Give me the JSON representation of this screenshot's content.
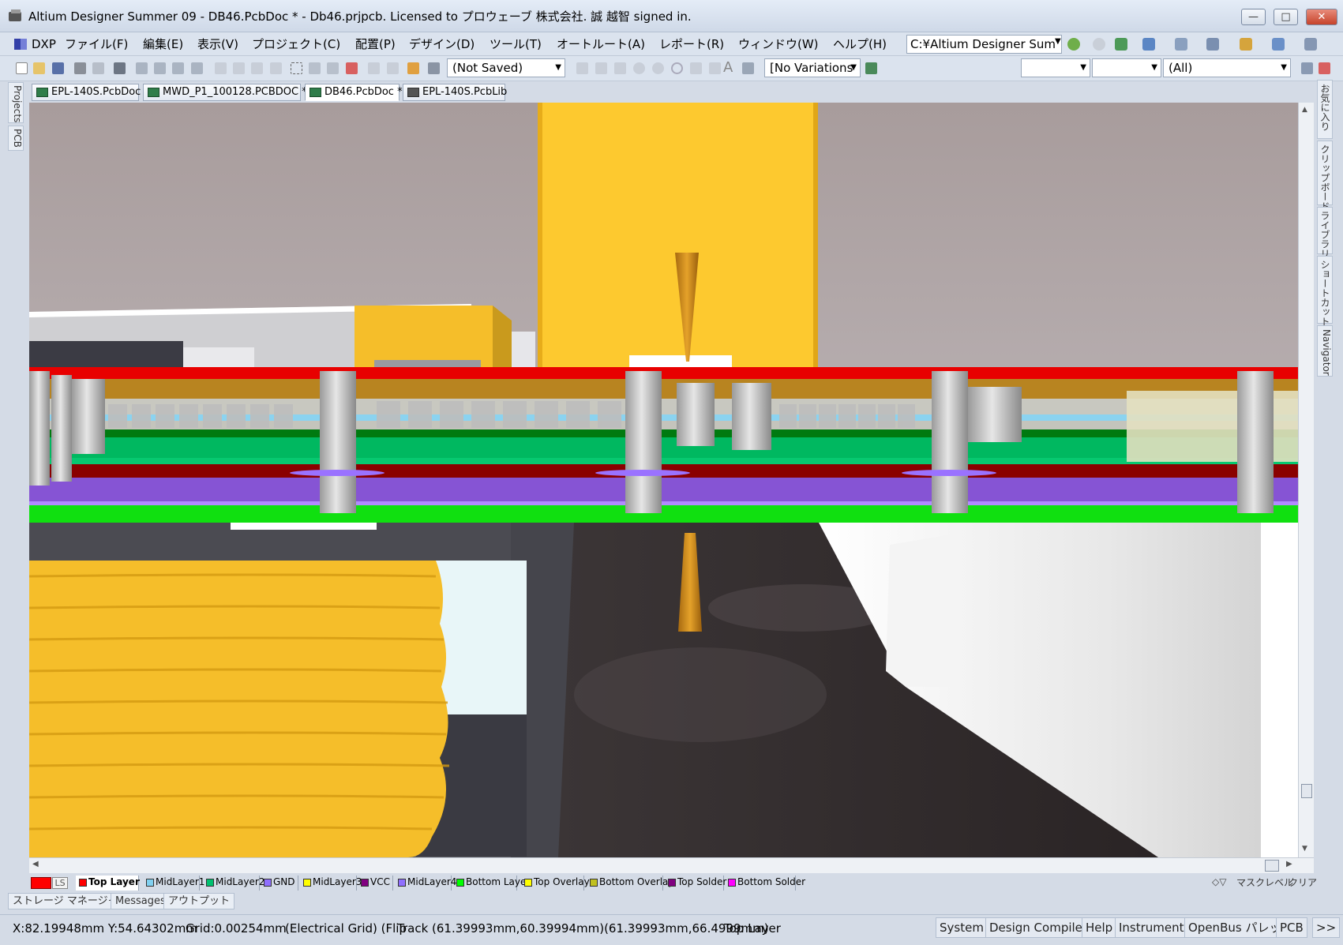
{
  "window": {
    "title": "Altium Designer Summer 09 - DB46.PcbDoc * - Db46.prjpcb. Licensed to プロウェーブ 株式会社. 誠 越智 signed in.",
    "minimize": "—",
    "maximize": "□",
    "close": "✕"
  },
  "menubar": {
    "dxp": "DXP",
    "items": [
      "ファイル(F)",
      "編集(E)",
      "表示(V)",
      "プロジェクト(C)",
      "配置(P)",
      "デザイン(D)",
      "ツール(T)",
      "オートルート(A)",
      "レポート(R)",
      "ウィンドウ(W)",
      "ヘルプ(H)"
    ],
    "path_combo": "C:¥Altium Designer Sum"
  },
  "toolbar": {
    "saved_state": "(Not Saved)",
    "variations": "[No Variations",
    "filter_all": "(All)"
  },
  "left_panels": [
    "Projects",
    "PCB"
  ],
  "right_panels": [
    "お気に入り",
    "クリップボード",
    "ライブラリ",
    "ショートカット",
    "Navigator"
  ],
  "doc_tabs": [
    "EPL-140S.PcbDoc",
    "MWD_P1_100128.PCBDOC *",
    "DB46.PcbDoc *",
    "EPL-140S.PcbLib"
  ],
  "layers": {
    "ls": "LS",
    "items": [
      {
        "label": "Top Layer",
        "color": "#ff0000"
      },
      {
        "label": "MidLayer1",
        "color": "#c08a2a"
      },
      {
        "label": "MidLayer2",
        "color": "#80d0f0"
      },
      {
        "label": "GND",
        "color": "#008000"
      },
      {
        "label": "MidLayer3",
        "color": "#00c070"
      },
      {
        "label": "VCC",
        "color": "#800000"
      },
      {
        "label": "MidLayer4",
        "color": "#9070ff"
      },
      {
        "label": "Bottom Layer",
        "color": "#00ff00"
      },
      {
        "label": "Top Overlay",
        "color": "#ffff00"
      },
      {
        "label": "Bottom Overlay",
        "color": "#c0c020"
      },
      {
        "label": "Top Solder",
        "color": "#800080"
      },
      {
        "label": "Bottom Solder",
        "color": "#ff00ff"
      }
    ],
    "mask_level": "マスクレベル",
    "clear": "クリア"
  },
  "panel_tabs": [
    "ストレージ マネージャ",
    "Messages",
    "アウトプット"
  ],
  "status": {
    "coords": "X:82.19948mm Y:54.64302mm",
    "grid": "Grid:0.00254mm",
    "grid_type": "(Electrical Grid) (Flip",
    "track": "Track (61.39993mm,60.39994mm)(61.39993mm,66.4999mm)",
    "layer": "Top Layer",
    "buttons": [
      "System",
      "Design Compiler",
      "Help",
      "Instruments",
      "OpenBus パレット",
      "PCB",
      ">>"
    ]
  }
}
